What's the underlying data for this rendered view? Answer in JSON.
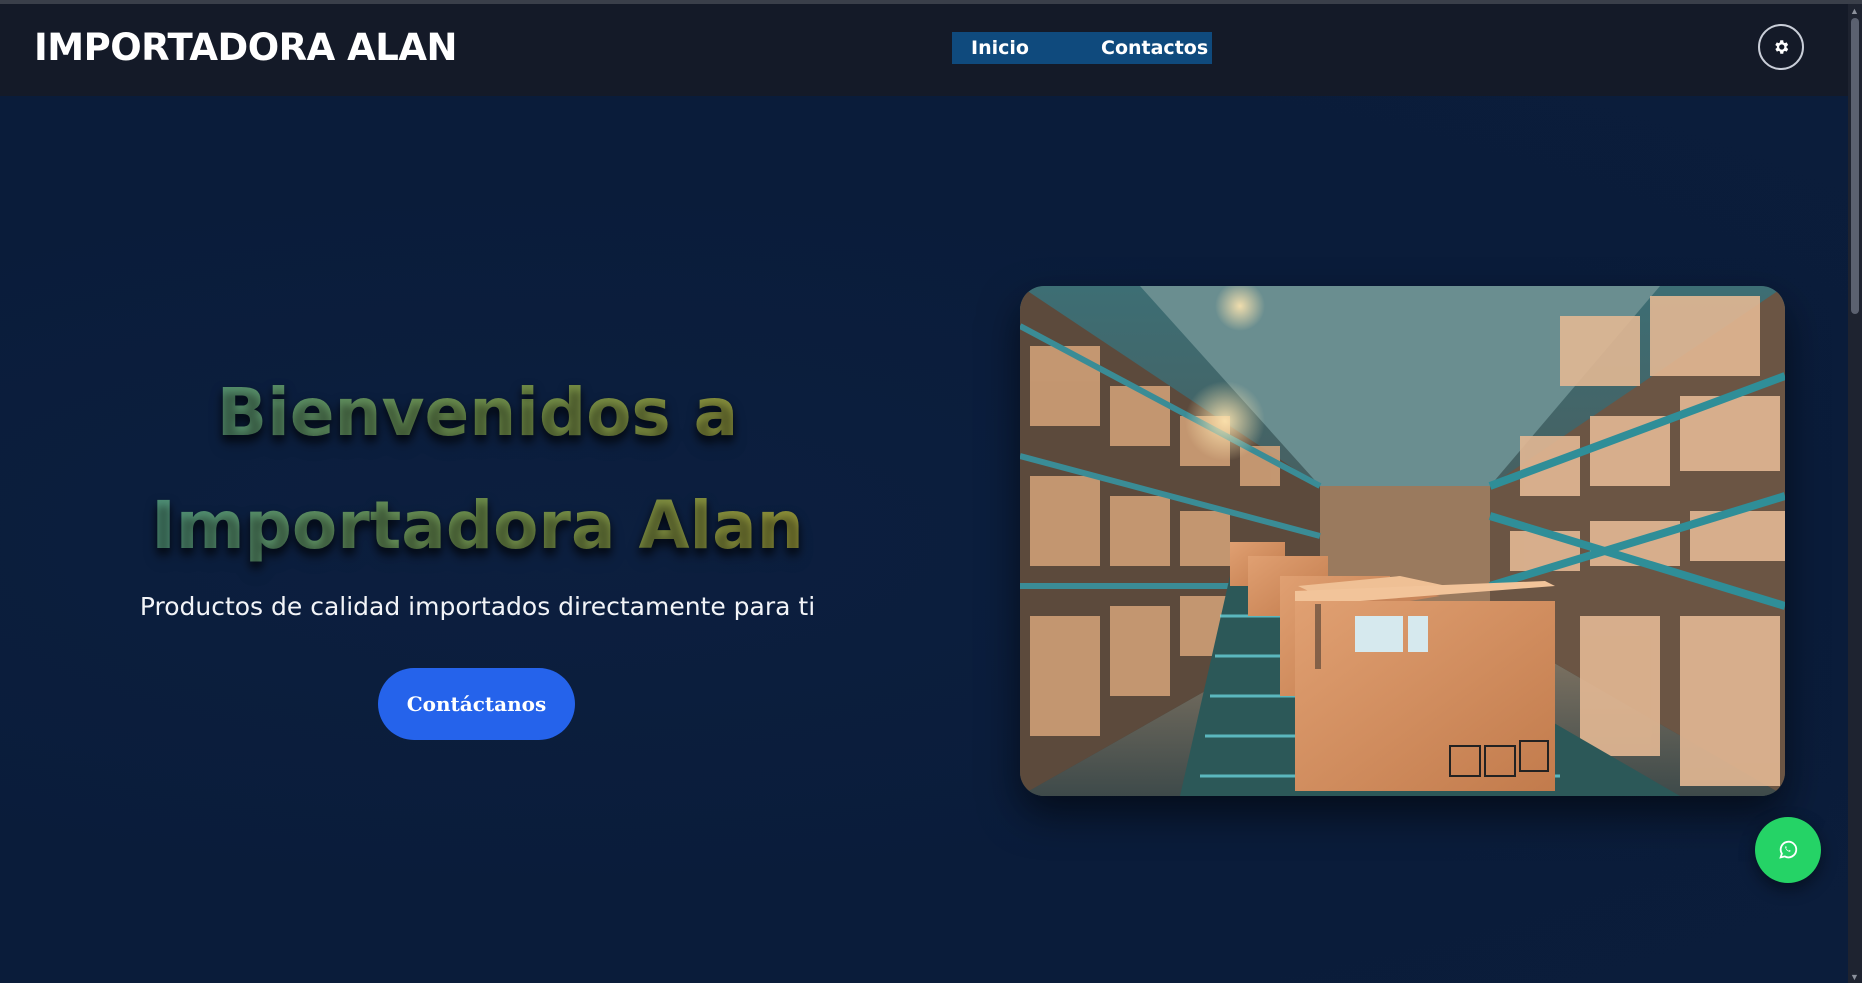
{
  "header": {
    "brand": "IMPORTADORA ALAN",
    "nav": [
      {
        "label": "Inicio"
      },
      {
        "label": "Contactos"
      }
    ],
    "theme_toggle_icon": "gear-icon"
  },
  "hero": {
    "title_line1": "Bienvenidos a",
    "title_line2": "Importadora Alan",
    "subtitle": "Productos de calidad importados directamente para ti",
    "cta_label": "Contáctanos",
    "image_icon": "warehouse-photo"
  },
  "floating": {
    "whatsapp_icon": "whatsapp-icon"
  },
  "colors": {
    "navbar_bg": "#141a28",
    "page_bg": "#0b1c3a",
    "nav_highlight": "#0f4a7d",
    "cta_bg": "#2563eb",
    "whatsapp_green": "#25d366"
  }
}
